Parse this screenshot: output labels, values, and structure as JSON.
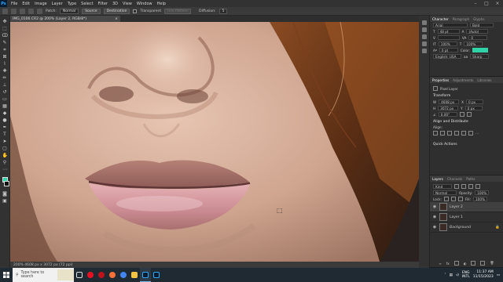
{
  "app": {
    "menu": [
      "File",
      "Edit",
      "Image",
      "Layer",
      "Type",
      "Select",
      "Filter",
      "3D",
      "View",
      "Window",
      "Help"
    ],
    "logo_text": "Ps"
  },
  "options": {
    "patch_label": "Patch:",
    "patch_value": "Normal",
    "source_btn": "Source",
    "destination_btn": "Destination",
    "transparent_label": "Transparent",
    "use_pattern_btn": "Use Pattern",
    "diffusion_label": "Diffusion:",
    "diffusion_value": "5"
  },
  "document": {
    "tab_title": "IMG_0106.CR2 @ 200% (Layer 2, RGB/8*)",
    "status_text": "200%   4608 px x 3072 px (72 ppi)"
  },
  "character": {
    "tabs": [
      "Character",
      "Paragraph",
      "Glyphs"
    ],
    "font_family": "Arial",
    "font_style": "Bold",
    "font_size": "48 pt",
    "leading": "(Auto)",
    "tracking": "0",
    "scale_v": "100%",
    "scale_h": "100%",
    "baseline": "0 pt",
    "language": "English: USA",
    "aa": "Sharp",
    "color": "#2fd3a6"
  },
  "properties": {
    "tabs": [
      "Properties",
      "Adjustments",
      "Libraries"
    ],
    "kind": "Pixel Layer",
    "transform_hdr": "Transform",
    "w": "4608 px",
    "h": "3072 px",
    "x": "0 px",
    "y": "0 px",
    "angle": "0.00°",
    "align_hdr": "Align and Distribute",
    "align_label": "Align:",
    "quick_hdr": "Quick Actions"
  },
  "layers": {
    "tabs": [
      "Layers",
      "Channels",
      "Paths"
    ],
    "kind_filter": "Kind",
    "blend_mode": "Normal",
    "opacity_label": "Opacity:",
    "opacity_value": "100%",
    "lock_label": "Lock:",
    "fill_label": "Fill:",
    "fill_value": "100%",
    "items": [
      {
        "name": "Layer 2"
      },
      {
        "name": "Layer 1"
      },
      {
        "name": "Background"
      }
    ]
  },
  "taskbar": {
    "search_placeholder": "Type here to search",
    "lang": "ENG",
    "region": "INTL",
    "time": "11:37 AM",
    "date": "11/15/2023"
  }
}
